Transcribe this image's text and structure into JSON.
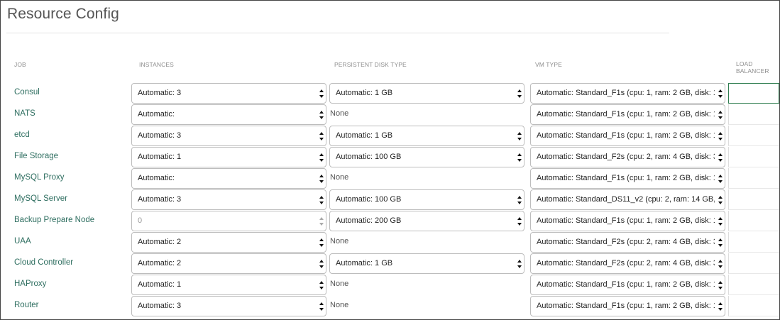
{
  "page": {
    "title": "Resource Config"
  },
  "columns": {
    "job": "JOB",
    "instances": "INSTANCES",
    "disk": "PERSISTENT DISK TYPE",
    "vm": "VM TYPE",
    "lb_line1": "LOAD",
    "lb_line2": "BALANCER"
  },
  "rows": [
    {
      "job": "Consul",
      "instances": "Automatic: 3",
      "disk": "Automatic: 1 GB",
      "vm": "Automatic: Standard_F1s (cpu: 1, ram: 2 GB, disk: 1"
    },
    {
      "job": "NATS",
      "instances": "Automatic:",
      "disk": "None",
      "vm": "Automatic: Standard_F1s (cpu: 1, ram: 2 GB, disk: 1"
    },
    {
      "job": "etcd",
      "instances": "Automatic: 3",
      "disk": "Automatic: 1 GB",
      "vm": "Automatic: Standard_F1s (cpu: 1, ram: 2 GB, disk: 1"
    },
    {
      "job": "File Storage",
      "instances": "Automatic: 1",
      "disk": "Automatic: 100 GB",
      "vm": "Automatic: Standard_F2s (cpu: 2, ram: 4 GB, disk: 3"
    },
    {
      "job": "MySQL Proxy",
      "instances": "Automatic:",
      "disk": "None",
      "vm": "Automatic: Standard_F1s (cpu: 1, ram: 2 GB, disk: 1"
    },
    {
      "job": "MySQL Server",
      "instances": "Automatic: 3",
      "disk": "Automatic: 100 GB",
      "vm": "Automatic: Standard_DS11_v2 (cpu: 2, ram: 14 GB,"
    },
    {
      "job": "Backup Prepare Node",
      "instances": "0",
      "disk": "Automatic: 200 GB",
      "vm": "Automatic: Standard_F1s (cpu: 1, ram: 2 GB, disk: 1"
    },
    {
      "job": "UAA",
      "instances": "Automatic: 2",
      "disk": "None",
      "vm": "Automatic: Standard_F2s (cpu: 2, ram: 4 GB, disk: 3"
    },
    {
      "job": "Cloud Controller",
      "instances": "Automatic: 2",
      "disk": "Automatic: 1 GB",
      "vm": "Automatic: Standard_F2s (cpu: 2, ram: 4 GB, disk: 3"
    },
    {
      "job": "HAProxy",
      "instances": "Automatic: 1",
      "disk": "None",
      "vm": "Automatic: Standard_F1s (cpu: 1, ram: 2 GB, disk: 1"
    },
    {
      "job": "Router",
      "instances": "Automatic: 3",
      "disk": "None",
      "vm": "Automatic: Standard_F1s (cpu: 1, ram: 2 GB, disk: 1"
    }
  ]
}
